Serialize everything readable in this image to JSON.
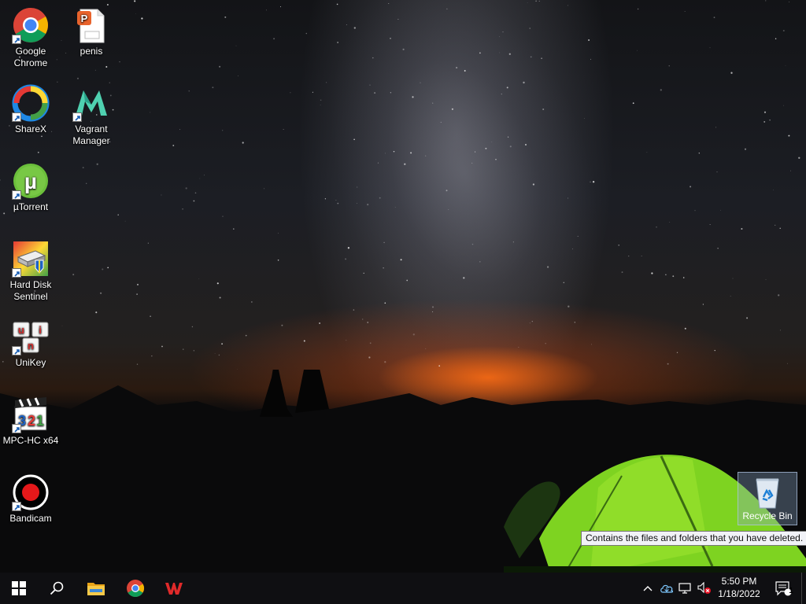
{
  "desktop": {
    "icons": [
      {
        "label": "Google Chrome",
        "icon": "chrome-icon"
      },
      {
        "label": "penis",
        "icon": "wps-presentation-file-icon"
      },
      {
        "label": "ShareX",
        "icon": "sharex-icon"
      },
      {
        "label": "Vagrant Manager",
        "icon": "vagrant-manager-icon"
      },
      {
        "label": "µTorrent",
        "icon": "utorrent-icon"
      },
      {
        "label": "Hard Disk Sentinel",
        "icon": "hard-disk-sentinel-icon"
      },
      {
        "label": "UniKey",
        "icon": "unikey-icon"
      },
      {
        "label": "MPC-HC x64",
        "icon": "mpc-hc-icon"
      },
      {
        "label": "Bandicam",
        "icon": "bandicam-icon"
      }
    ],
    "recycle_bin": {
      "label": "Recycle Bin",
      "tooltip": "Contains the files and folders that you have deleted."
    }
  },
  "taskbar": {
    "pinned": [
      {
        "icon": "windows-start-icon"
      },
      {
        "icon": "search-icon"
      },
      {
        "icon": "file-explorer-icon"
      },
      {
        "icon": "chrome-icon"
      },
      {
        "icon": "wps-office-icon"
      }
    ],
    "tray": {
      "icons": [
        "chevron-up-icon",
        "onedrive-cloud-icon",
        "network-icon",
        "volume-muted-icon"
      ],
      "time": "5:50 PM",
      "date": "1/18/2022",
      "notification_count": "1"
    }
  },
  "colors": {
    "taskbar_bg": "#0f0f12",
    "tent_green": "#7ed321",
    "sky_glow": "#ff6e14",
    "selection": "#8caac8"
  }
}
